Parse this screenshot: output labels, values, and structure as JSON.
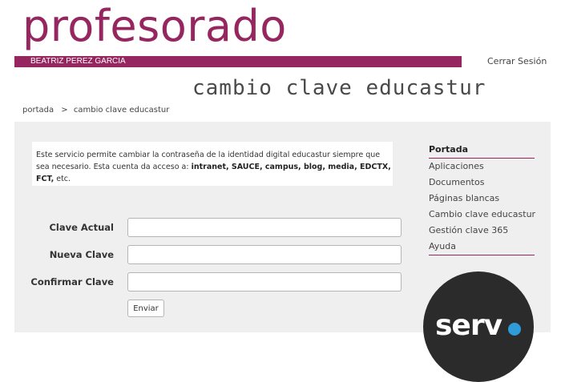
{
  "header": {
    "brand": "profesorado",
    "username": "BEATRIZ PEREZ GARCIA",
    "logout_label": "Cerrar Sesión",
    "page_title": "cambio clave educastur"
  },
  "breadcrumb": {
    "home": "portada",
    "separator": ">",
    "current": "cambio clave educastur"
  },
  "notice": {
    "text_before": "Este servicio permite cambiar la contraseña de la identidad digital educastur siempre que sea necesario. Esta cuenta da acceso a: ",
    "services": "intranet, SAUCE, campus, blog, media, EDCTX, FCT,",
    "text_after": " etc."
  },
  "form": {
    "fields": [
      {
        "label": "Clave Actual",
        "value": "",
        "placeholder": ""
      },
      {
        "label": "Nueva Clave",
        "value": "",
        "placeholder": ""
      },
      {
        "label": "Confirmar Clave",
        "value": "",
        "placeholder": ""
      }
    ],
    "submit_label": "Enviar"
  },
  "sidebar": {
    "items": [
      {
        "label": "Portada"
      },
      {
        "label": "Aplicaciones"
      },
      {
        "label": "Documentos"
      },
      {
        "label": "Páginas blancas"
      },
      {
        "label": "Cambio clave educastur"
      },
      {
        "label": "Gestión clave 365"
      },
      {
        "label": "Ayuda"
      }
    ]
  },
  "badge": {
    "text": "serv"
  },
  "colors": {
    "brand": "#95265f",
    "content_bg": "#efefef",
    "badge_bg": "#2b2b2b",
    "badge_dot": "#2f9bd8"
  }
}
